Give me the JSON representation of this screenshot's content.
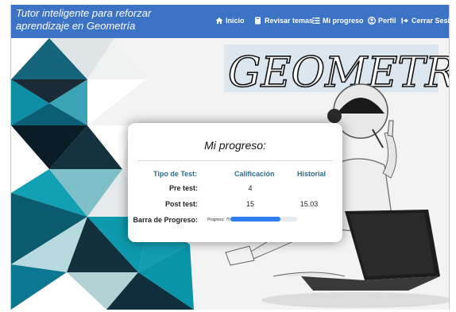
{
  "navbar": {
    "brand": "Tutor inteligente para reforzar aprendizaje en Geometría",
    "items": [
      {
        "label": "Inicio",
        "icon": "home-icon"
      },
      {
        "label": "Revisar temas",
        "icon": "book-icon"
      },
      {
        "label": "Mi progreso",
        "icon": "list-icon"
      },
      {
        "label": "Perfil",
        "icon": "user-icon"
      },
      {
        "label": "Cerrar Sesión",
        "icon": "logout-icon"
      }
    ],
    "color": "#3c73c4"
  },
  "hero": {
    "title_art": "GEOMETRIA"
  },
  "progress_card": {
    "title": "Mi progreso:",
    "headers": [
      "Tipo de Test:",
      "Calificación",
      "Historial"
    ],
    "rows": [
      {
        "label": "Pre test:",
        "score": "4",
        "history": ""
      },
      {
        "label": "Post test:",
        "score": "15",
        "history": "15.03"
      }
    ],
    "bar_label": "Barra de Progreso:",
    "bar_text": "Progreso: 75 %",
    "bar_percent": 75,
    "bar_color": "#2d7ef0"
  }
}
